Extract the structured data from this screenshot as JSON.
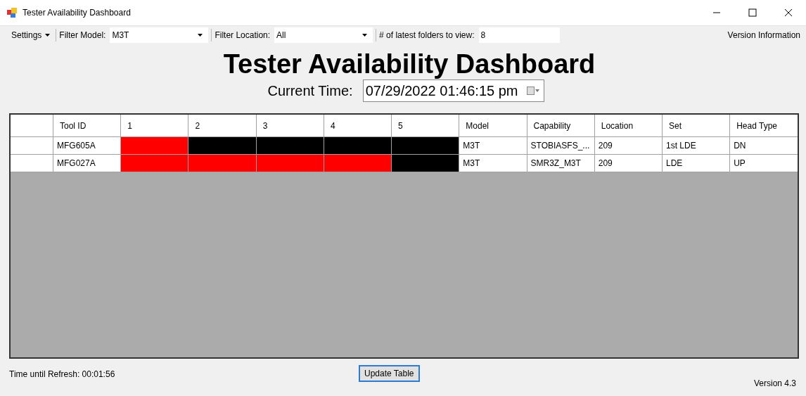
{
  "window": {
    "title": "Tester Availability Dashboard"
  },
  "toolbar": {
    "settings": "Settings",
    "filter_model_label": "Filter Model:",
    "filter_model": "M3T",
    "filter_location_label": "Filter Location:",
    "filter_location": "All",
    "folders_label": "# of latest folders to view:",
    "folders": "8",
    "version_info": "Version Information"
  },
  "heading": "Tester Availability Dashboard",
  "current_time": {
    "label": "Current Time:",
    "value": "07/29/2022 01:46:15 pm"
  },
  "table": {
    "columns": [
      "Tool ID",
      "1",
      "2",
      "3",
      "4",
      "5",
      "Model",
      "Capability",
      "Location",
      "Set",
      "Head Type"
    ],
    "rows": [
      {
        "tool_id": "MFG605A",
        "slots": [
          {
            "color": "#ff0000"
          },
          {
            "color": "#000000"
          },
          {
            "color": "#000000"
          },
          {
            "color": "#000000"
          },
          {
            "color": "#000000"
          }
        ],
        "model": "M3T",
        "capability": "STOBIASFS_...",
        "location": "209",
        "set": "1st LDE",
        "head_type": "DN"
      },
      {
        "tool_id": "MFG027A",
        "slots": [
          {
            "color": "#ff0000"
          },
          {
            "color": "#ff0000"
          },
          {
            "color": "#ff0000"
          },
          {
            "color": "#ff0000"
          },
          {
            "color": "#000000"
          }
        ],
        "model": "M3T",
        "capability": "SMR3Z_M3T",
        "location": "209",
        "set": "LDE",
        "head_type": "UP"
      }
    ]
  },
  "footer": {
    "refresh": "Time until Refresh: 00:01:56",
    "update_button": "Update Table",
    "version": "Version 4.3"
  }
}
